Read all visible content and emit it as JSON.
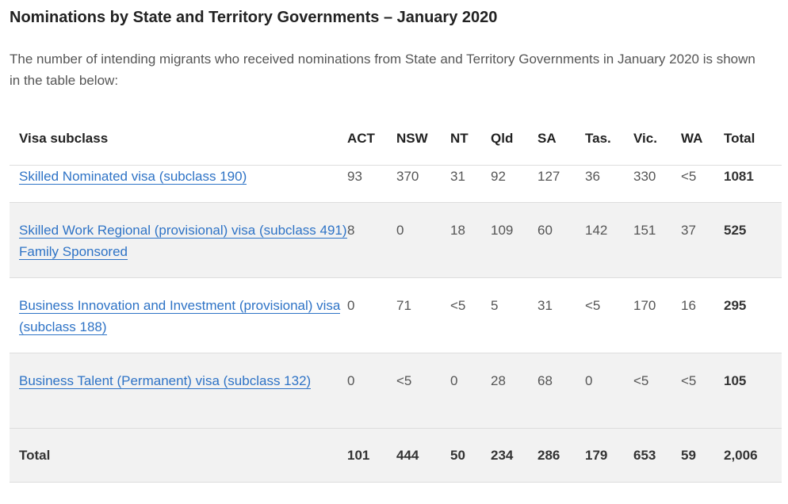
{
  "heading": "Nominations by State and Territory Governments – January 2020",
  "intro": "The number of intending migrants who received nominations from State and Territory Governments in January 2020 is shown in the table below:",
  "colors": {
    "link": "#2e73c6",
    "row_shade": "#f2f2f2",
    "divider": "#dddddd"
  },
  "table": {
    "headers": [
      "Visa subclass",
      "ACT",
      "NSW",
      "NT",
      "Qld",
      "SA",
      "Tas.",
      "Vic.",
      "WA",
      "Total"
    ],
    "rows": [
      {
        "visa": "Skilled Nominated visa (subclass 190)",
        "values": [
          "93",
          "370",
          "31",
          "92",
          "127",
          "36",
          "330",
          "<5"
        ],
        "total": "1081"
      },
      {
        "visa": "Skilled Work Regional (provisional) visa (subclass 491) Family Sponsored",
        "values": [
          "8",
          "0",
          "18",
          "109",
          "60",
          "142",
          "151",
          "37"
        ],
        "total": "525"
      },
      {
        "visa": "Business Innovation and Investment (provisional) visa (subclass 188)",
        "values": [
          "0",
          "71",
          "<5",
          "5",
          "31",
          "<5",
          "170",
          "16"
        ],
        "total": "295"
      },
      {
        "visa": "Business Talent (Permanent) visa (subclass 132)",
        "values": [
          "0",
          "<5",
          "0",
          "28",
          "68",
          "0",
          "<5",
          "<5"
        ],
        "total": "105"
      }
    ],
    "footer": {
      "label": "Total",
      "values": [
        "101",
        "444",
        "50",
        "234",
        "286",
        "179",
        "653",
        "59"
      ],
      "total": "2,006"
    }
  }
}
